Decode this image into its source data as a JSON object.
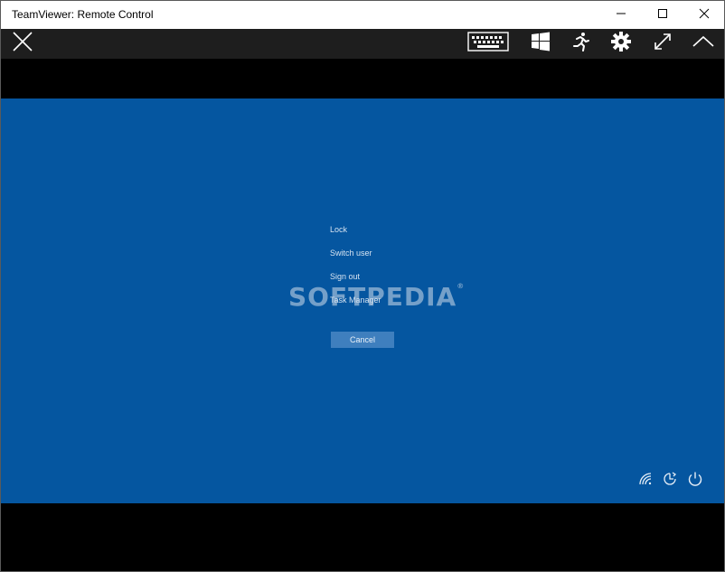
{
  "window": {
    "title": "TeamViewer: Remote Control",
    "controls": [
      "minimize-icon",
      "maximize-icon",
      "close-icon"
    ]
  },
  "toolbar": {
    "icons": [
      "close-session-icon",
      "keyboard-icon",
      "windows-icon",
      "run-icon",
      "gear-icon",
      "expand-icon",
      "collapse-icon"
    ],
    "background": "#1e1e1e"
  },
  "remote_screen": {
    "background": "#0556a0",
    "menu": {
      "items": [
        "Lock",
        "Switch user",
        "Sign out",
        "Task Manager"
      ]
    },
    "cancel_label": "Cancel",
    "tray_icons": [
      "wifi-icon",
      "ease-of-access-icon",
      "power-icon"
    ]
  },
  "watermark": {
    "text": "SOFTPEDIA",
    "mark": "®"
  }
}
